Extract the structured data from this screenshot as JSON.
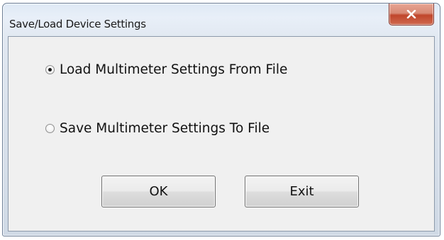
{
  "window": {
    "title": "Save/Load Device Settings",
    "close_icon": "close-x-icon"
  },
  "options": [
    {
      "label": "Load Multimeter Settings From File",
      "selected": true
    },
    {
      "label": "Save Multimeter Settings To File",
      "selected": false
    }
  ],
  "buttons": {
    "ok_label": "OK",
    "exit_label": "Exit"
  },
  "colors": {
    "close_button": "#c0462c"
  }
}
